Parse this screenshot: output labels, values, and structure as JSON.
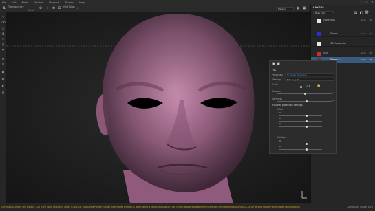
{
  "menu": [
    "File",
    "Edit",
    "Mode",
    "Window",
    "Viewport",
    "Plugins",
    "Help"
  ],
  "toolbar": {
    "mode_label": "Transparency",
    "projection_label": "Rotat",
    "projection_value": "None",
    "slider_label": "Grid Align",
    "zoom_value": "0",
    "material_select": "Material"
  },
  "layers": {
    "title": "LAYERS",
    "blend_mode": "Base Color",
    "rows": [
      {
        "name": "Glossiness",
        "blend": "Norm",
        "opacity": "100",
        "color": "#e6e6e6"
      },
      {
        "name": "Decals 1",
        "blend": "Norm",
        "opacity": "100",
        "color": "#2d2dd8"
      },
      {
        "name": "SSS Pass/color",
        "blend": "",
        "opacity": "",
        "color": "#e8e8e8"
      },
      {
        "name": "Skin",
        "blend": "Norm",
        "opacity": "100",
        "color": "#d42a2a"
      },
      {
        "name": "Decals 2",
        "blend": "Norm",
        "opacity": "100",
        "color": "#444444"
      }
    ]
  },
  "properties": {
    "section": "FILL",
    "projection_label": "Projection",
    "projection_value": "Tri-planar projection",
    "filtering_label": "Filtering",
    "filtering_value": "Bilinear | HQ",
    "scale_label": "Scale",
    "scale_value": "14.5",
    "rotation_label": "Rotation",
    "rotation_value": "0",
    "hardness_label": "Hardness",
    "hardness_value": "0.5",
    "tri_label": "Triplanar projection settings",
    "offset_label": "Offset",
    "rotation2_label": "Rotation",
    "offset_values": [
      "0",
      "0",
      "0"
    ],
    "rotation2_values": [
      "0",
      "0",
      "0"
    ]
  },
  "status": {
    "message": "[GPUIssuesCheck] The current TDR (GPU hang recovery) delay is low: 2s. Substance Painter can be interrupted by the OS when doing a long computation. See https://support.allegorithmic.com/documentation/display/SPDOC/GPU+drivers+crash+with+long+computations",
    "right_text": "Cache Disk Usage: 83%"
  },
  "colors": {
    "accent": "#4a8fe0",
    "warning": "#d4a31c",
    "panel_bg": "#262626"
  }
}
